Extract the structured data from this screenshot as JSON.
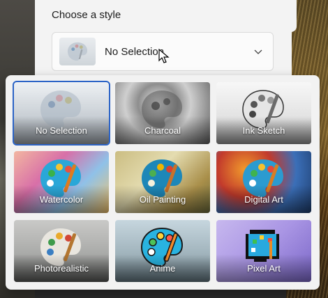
{
  "settings": {
    "section_title": "Choose a style",
    "selected_value": "No Selection"
  },
  "flyout": {
    "options": [
      {
        "label": "No Selection",
        "selected": true
      },
      {
        "label": "Charcoal",
        "selected": false
      },
      {
        "label": "Ink Sketch",
        "selected": false
      },
      {
        "label": "Watercolor",
        "selected": false
      },
      {
        "label": "Oil Painting",
        "selected": false
      },
      {
        "label": "Digital Art",
        "selected": false
      },
      {
        "label": "Photorealistic",
        "selected": false
      },
      {
        "label": "Anime",
        "selected": false
      },
      {
        "label": "Pixel Art",
        "selected": false
      }
    ]
  },
  "colors": {
    "accent": "#2b63c6",
    "panel": "#f3f3f3",
    "flyout": "#f2f2f2",
    "palette_blue": "#2aa7d8"
  },
  "icons": {
    "select_thumb": "palette-icon",
    "dropdown": "chevron-down-icon",
    "pointer": "mouse-cursor-icon"
  }
}
